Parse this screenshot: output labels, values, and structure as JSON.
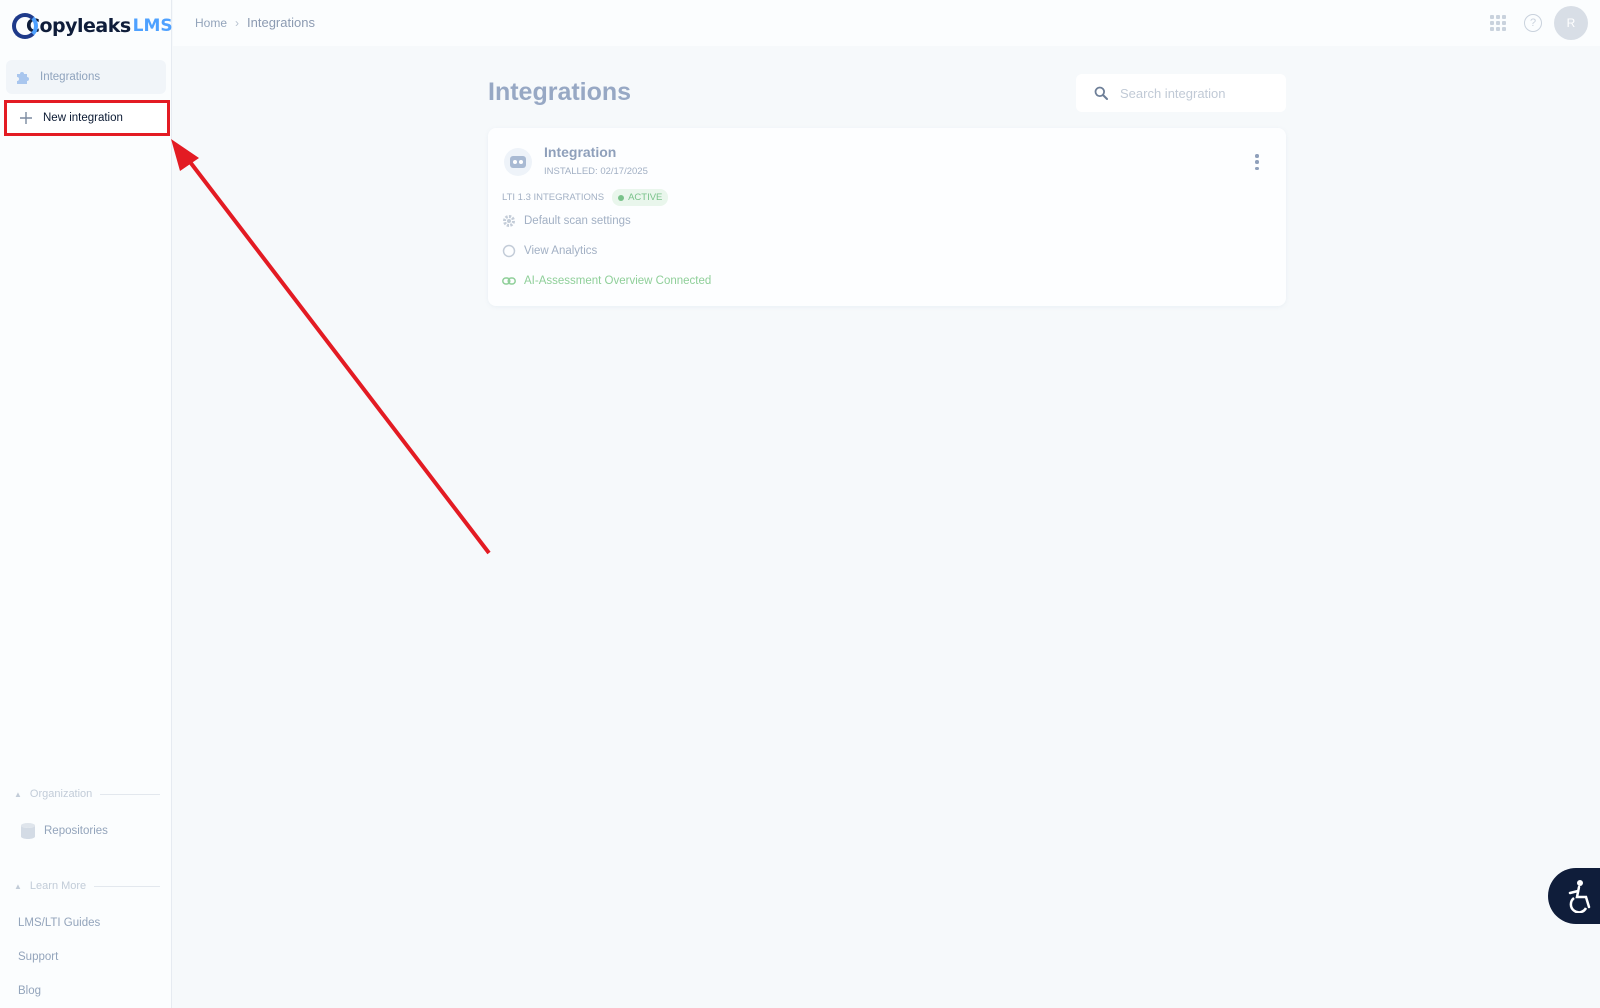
{
  "brand": {
    "name": "Copyleaks",
    "suffix": "LMS",
    "accent_color": "#4ea1ff",
    "dark_color": "#0f1d3a"
  },
  "sidebar": {
    "integrations_label": "Integrations",
    "new_integration_label": "New integration",
    "organization_heading": "Organization",
    "repositories_label": "Repositories",
    "learn_more_heading": "Learn More",
    "learn_more_links": [
      "LMS/LTI Guides",
      "Support",
      "Blog"
    ]
  },
  "topbar": {
    "breadcrumb_home": "Home",
    "breadcrumb_current": "Integrations",
    "avatar_initial": "R"
  },
  "main": {
    "title": "Integrations",
    "search_placeholder": "Search integration",
    "card": {
      "title": "Integration",
      "installed": "INSTALLED: 02/17/2025",
      "type": "LTI 1.3 INTEGRATIONS",
      "status": "ACTIVE",
      "status_color": "#79c28a",
      "links": [
        "Default scan settings",
        "View Analytics",
        "AI-Assessment Overview Connected"
      ]
    }
  },
  "annotation": {
    "highlight_color": "#e31b23"
  }
}
